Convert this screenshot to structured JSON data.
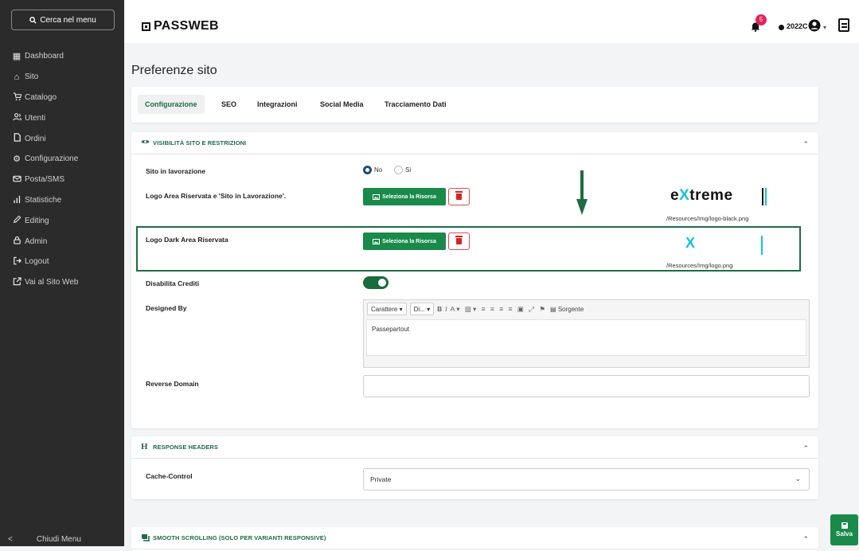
{
  "sidebar": {
    "search_label": "Cerca nel menu",
    "items": [
      {
        "label": "Dashboard",
        "icon": "grid-icon"
      },
      {
        "label": "Sito",
        "icon": "home-icon"
      },
      {
        "label": "Catalogo",
        "icon": "cart-icon"
      },
      {
        "label": "Utenti",
        "icon": "users-icon"
      },
      {
        "label": "Ordini",
        "icon": "document-icon"
      },
      {
        "label": "Configurazione",
        "icon": "gear-icon"
      },
      {
        "label": "Posta/SMS",
        "icon": "envelope-icon"
      },
      {
        "label": "Statistiche",
        "icon": "bar-chart-icon"
      },
      {
        "label": "Editing",
        "icon": "pencil-icon"
      },
      {
        "label": "Admin",
        "icon": "lock-icon"
      },
      {
        "label": "Logout",
        "icon": "logout-icon"
      },
      {
        "label": "Vai al Sito Web",
        "icon": "external-link-icon"
      }
    ],
    "close_label": "Chiudi Menu"
  },
  "header": {
    "brand": "PASSWEB",
    "notifications": "5",
    "user": "2022C"
  },
  "page": {
    "title": "Preferenze sito"
  },
  "tabs": [
    "Configurazione",
    "SEO",
    "Integrazioni",
    "Social Media",
    "Tracciamento Dati"
  ],
  "visibility": {
    "title": "VISIBILITÀ SITO E RESTRIZIONI",
    "site_wip_label": "Sito in lavorazione",
    "radio_no": "No",
    "radio_si": "Si",
    "radio_selected": "No",
    "logo_reserved_label": "Logo Area Riservata e 'Sito in Lavorazione'.",
    "select_resource": "Seleziona la Risorsa",
    "logo_black_path": "/Resources/Img/logo-black.png",
    "logo_dark_label": "Logo Dark Area Riservata",
    "logo_path": "/Resources/Img/logo.png",
    "logo_text_pre": "e",
    "logo_text_x": "X",
    "logo_text_post": "treme",
    "logo_dark_text": "X",
    "disable_credits_label": "Disabilita Crediti",
    "disable_credits_on": true,
    "designed_by_label": "Designed By",
    "editor_font": "Carattere",
    "editor_size": "Di...",
    "editor_source": "Sorgente",
    "designed_by_value": "Passepartout",
    "reverse_domain_label": "Reverse Domain",
    "reverse_domain_value": ""
  },
  "response_headers": {
    "title": "RESPONSE HEADERS",
    "cache_label": "Cache-Control",
    "cache_value": "Private"
  },
  "smooth": {
    "title": "SMOOTH SCROLLING (SOLO PER VARIANTI RESPONSIVE)"
  },
  "save_label": "Salva",
  "colors": {
    "accent": "#1e6b45",
    "button": "#1a8a4a",
    "sidebar": "#2b2b2b",
    "logo_cyan": "#12c5d9",
    "badge": "#e2245a"
  }
}
